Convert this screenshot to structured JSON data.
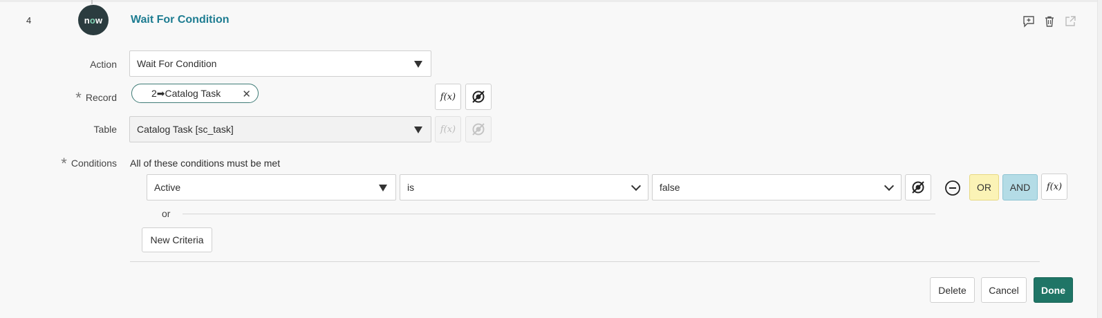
{
  "step": {
    "number": "4",
    "logo_text_pre": "n",
    "logo_text_o": "o",
    "logo_text_post": "w",
    "title": "Wait For Condition",
    "icons": [
      "add-comment-icon",
      "trash-icon",
      "popout-icon"
    ]
  },
  "form": {
    "action": {
      "label": "Action",
      "value": "Wait For Condition"
    },
    "record": {
      "label": "Record",
      "pill_text": "2➡Catalog Task",
      "remove_glyph": "✕"
    },
    "table": {
      "label": "Table",
      "value": "Catalog Task [sc_task]"
    },
    "conditions": {
      "label": "Conditions",
      "description": "All of these conditions must be met",
      "rows": [
        {
          "field": "Active",
          "operator": "is",
          "value": "false"
        }
      ],
      "or_label": "or",
      "or_button": "OR",
      "and_button": "AND",
      "new_criteria": "New Criteria"
    },
    "fx_label": "f(x)"
  },
  "footer": {
    "delete": "Delete",
    "cancel": "Cancel",
    "done": "Done"
  },
  "colors": {
    "title": "#1d7c91",
    "done_bg": "#1f7566",
    "or_bg": "#fbf3b6",
    "and_bg": "#b4dce6",
    "logo_bg": "#2b3c3f"
  }
}
